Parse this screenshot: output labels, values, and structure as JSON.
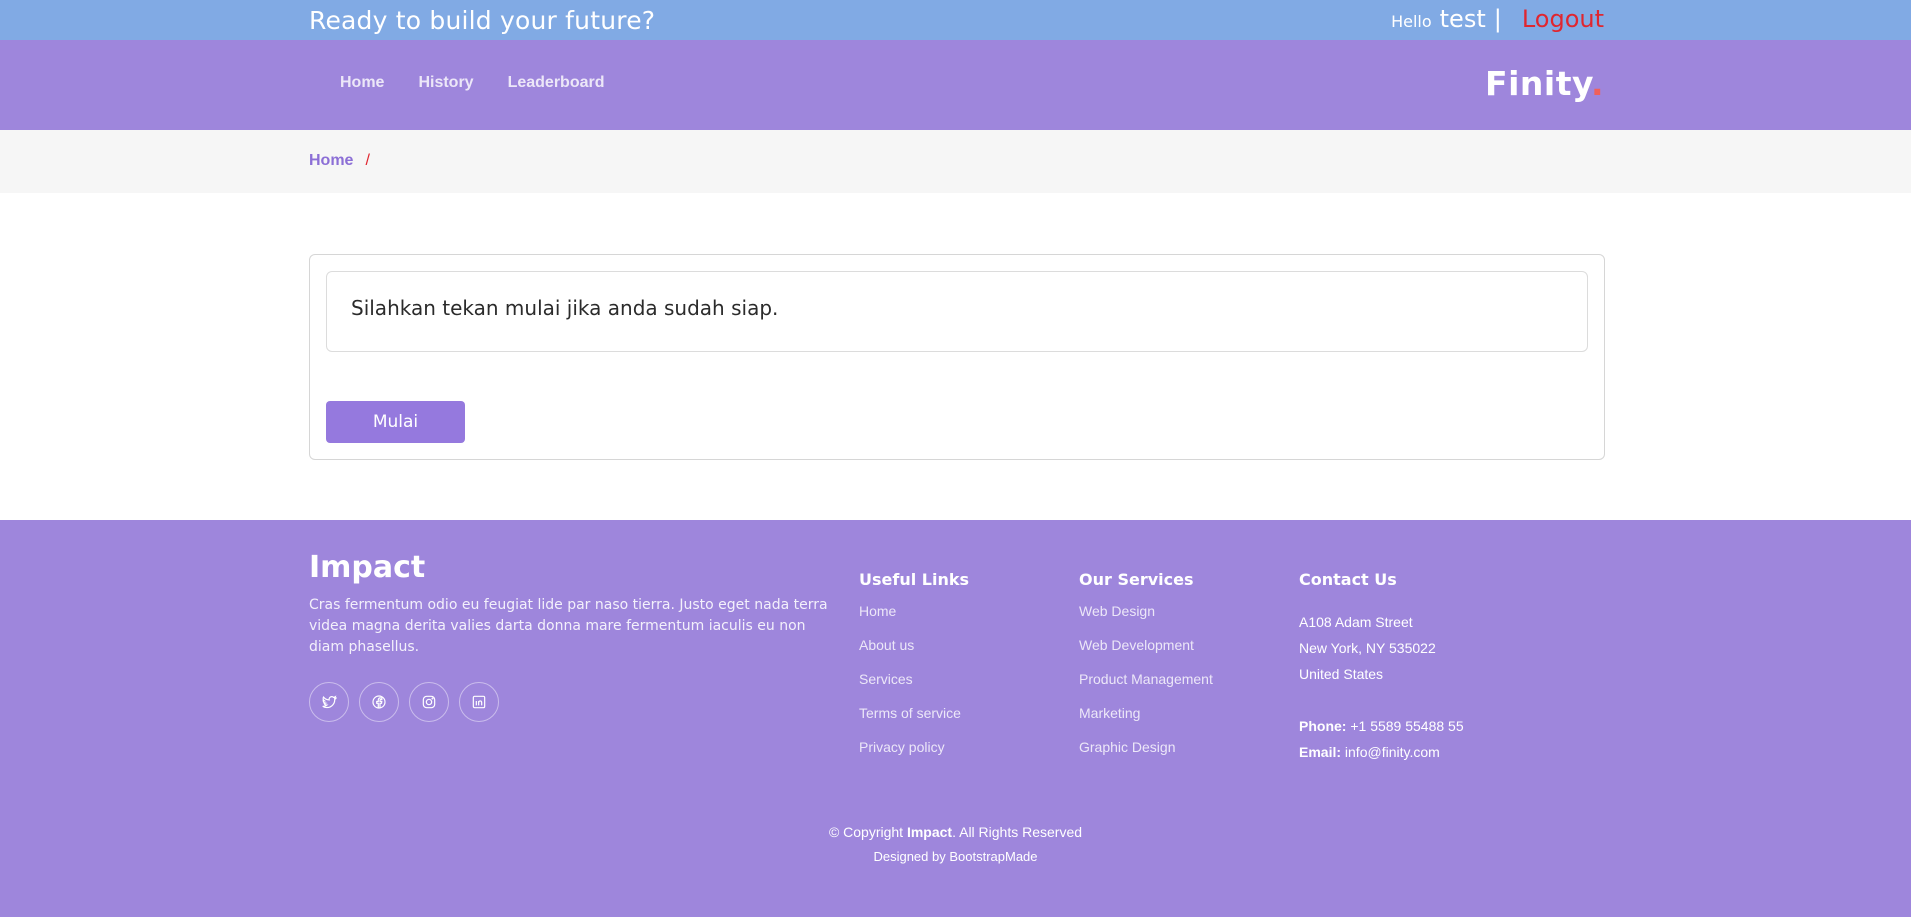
{
  "topbar": {
    "tagline": "Ready to build your future?",
    "hello": "Hello",
    "username": "test",
    "separator": "|",
    "logout": "Logout"
  },
  "nav": {
    "items": [
      {
        "label": "Home"
      },
      {
        "label": "History"
      },
      {
        "label": "Leaderboard"
      }
    ],
    "brand": "Finity",
    "brand_dot": "."
  },
  "breadcrumb": {
    "home": "Home",
    "separator": "/"
  },
  "quiz": {
    "message": "Silahkan tekan mulai jika anda sudah siap.",
    "start_button": "Mulai"
  },
  "footer": {
    "logo": "Impact",
    "about": "Cras fermentum odio eu feugiat lide par naso tierra. Justo eget nada terra videa magna derita valies darta donna mare fermentum iaculis eu non diam phasellus.",
    "social": [
      "twitter-icon",
      "facebook-icon",
      "instagram-icon",
      "linkedin-icon"
    ],
    "useful_links": {
      "title": "Useful Links",
      "items": [
        "Home",
        "About us",
        "Services",
        "Terms of service",
        "Privacy policy"
      ]
    },
    "services": {
      "title": "Our Services",
      "items": [
        "Web Design",
        "Web Development",
        "Product Management",
        "Marketing",
        "Graphic Design"
      ]
    },
    "contact": {
      "title": "Contact Us",
      "address_1": "A108 Adam Street",
      "address_2": "New York, NY 535022",
      "address_3": "United States",
      "phone_label": "Phone:",
      "phone": "+1 5589 55488 55",
      "email_label": "Email:",
      "email": "info@finity.com"
    },
    "copyright_prefix": "© Copyright",
    "copyright_brand": "Impact",
    "copyright_suffix": ". All Rights Reserved",
    "credits": "Designed by BootstrapMade"
  },
  "colors": {
    "topbar": "#81aae4",
    "navbar": "#9e86dc",
    "accent_red": "#e0262f",
    "button": "#9579de"
  }
}
